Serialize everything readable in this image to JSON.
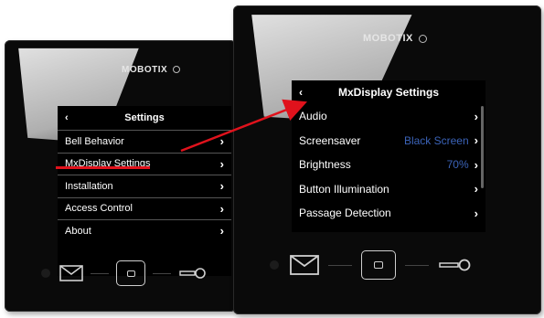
{
  "left_device": {
    "logo_text": "MOBOTIX",
    "screen": {
      "title": "Settings",
      "back_symbol": "‹",
      "items": [
        {
          "label": "Bell Behavior"
        },
        {
          "label": "MxDisplay Settings"
        },
        {
          "label": "Installation"
        },
        {
          "label": "Access Control"
        },
        {
          "label": "About"
        }
      ]
    }
  },
  "right_device": {
    "logo_text": "MOBOTIX",
    "screen": {
      "title": "MxDisplay Settings",
      "back_symbol": "‹",
      "items": [
        {
          "label": "Audio",
          "value": ""
        },
        {
          "label": "Screensaver",
          "value": "Black Screen"
        },
        {
          "label": "Brightness",
          "value": "70%"
        },
        {
          "label": "Button Illumination",
          "value": ""
        },
        {
          "label": "Passage Detection",
          "value": ""
        }
      ]
    }
  },
  "chevron": "›",
  "icons": [
    "envelope-icon",
    "square-button-icon",
    "key-icon",
    "chevron-right-icon",
    "back-arrow-icon"
  ],
  "colors": {
    "highlight_red": "#e0121c",
    "value_blue": "#3b63b8",
    "device_black": "#0a0a0a"
  }
}
